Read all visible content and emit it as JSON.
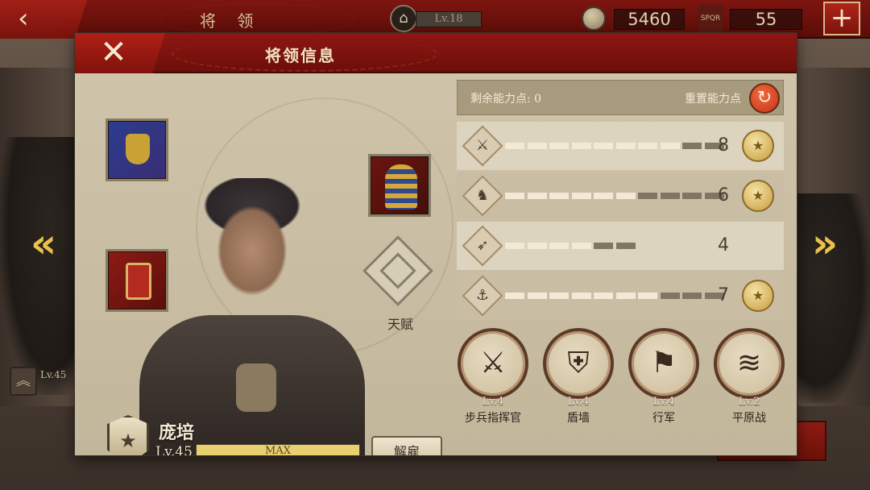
{
  "topbar": {
    "back_icon": "arrow-left-icon",
    "title": "将 领",
    "city_level": "Lv.18",
    "coins": "5460",
    "spqr_icon_text": "SPQR",
    "spqr": "55",
    "plus_icon": "plus-icon"
  },
  "background": {
    "left_general_level": "Lv.45"
  },
  "panel": {
    "title": "将领信息",
    "close_icon": "close-icon",
    "talent_label": "天赋",
    "hero": {
      "name": "庞培",
      "level": "Lv.45",
      "xp_text": "MAX",
      "dismiss_label": "解雇"
    },
    "equipment": [
      {
        "name": "banner",
        "icon": "banner-icon"
      },
      {
        "name": "shield",
        "icon": "shield-icon"
      },
      {
        "name": "pharaoh-mask",
        "icon": "pharaoh-mask-icon"
      }
    ],
    "points": {
      "remaining_label": "剩余能力点: 0",
      "reset_label": "重置能力点"
    },
    "stats": [
      {
        "name": "infantry",
        "icon": "sword-icon",
        "value": "8",
        "max_segments": 10,
        "filled": 8,
        "medal": true
      },
      {
        "name": "cavalry",
        "icon": "horse-icon",
        "value": "6",
        "max_segments": 10,
        "filled": 6,
        "medal": true
      },
      {
        "name": "archery",
        "icon": "bow-icon",
        "value": "4",
        "max_segments": 6,
        "filled": 4,
        "medal": false
      },
      {
        "name": "navy",
        "icon": "anchor-icon",
        "value": "7",
        "max_segments": 10,
        "filled": 7,
        "medal": true
      }
    ],
    "skills": [
      {
        "name": "步兵指挥官",
        "level": "Lv.4",
        "icon": "crossed-swords-icon"
      },
      {
        "name": "盾墙",
        "level": "Lv.4",
        "icon": "shield-wall-icon"
      },
      {
        "name": "行军",
        "level": "Lv.4",
        "icon": "march-icon"
      },
      {
        "name": "平原战",
        "level": "Lv.2",
        "icon": "plains-icon"
      }
    ]
  },
  "colors": {
    "header_red": "#8e1712",
    "panel_bg": "#c9bda3",
    "gold": "#e8cf70",
    "arrow_gold": "#e8c24a"
  }
}
